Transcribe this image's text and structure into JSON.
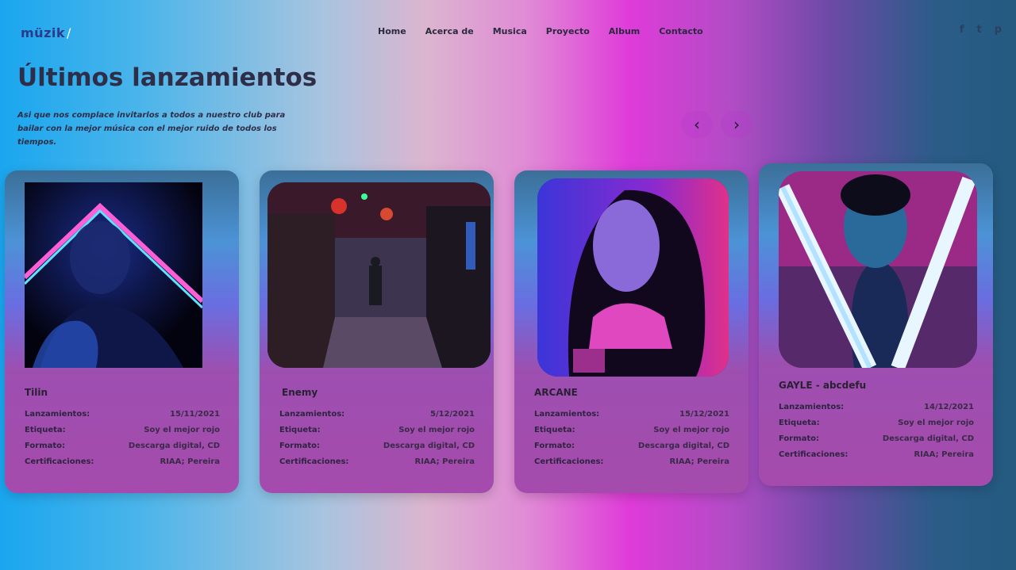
{
  "brand": {
    "logo": "müzik",
    "logo_mark": "/"
  },
  "nav": [
    "Home",
    "Acerca de",
    "Musica",
    "Proyecto",
    "Album",
    "Contacto"
  ],
  "social": {
    "facebook": "f",
    "twitter": "t",
    "pinterest": "p"
  },
  "hero": {
    "title": "Últimos lanzamientos",
    "subtitle": "Asi que nos complace invitarlos a todos a nuestro club para bailar con la mejor música con el mejor ruido de todos los tiempos."
  },
  "carousel": {
    "prev": "‹",
    "next": "›"
  },
  "field_labels": {
    "release": "Lanzamientos:",
    "label": "Etiqueta:",
    "format": "Formato:",
    "certs": "Certificaciones:"
  },
  "cards": [
    {
      "title": "Tilin",
      "release": "15/11/2021",
      "label": "Soy el mejor rojo",
      "format": "Descarga digital, CD",
      "certs": "RIAA; Pereira"
    },
    {
      "title": "Enemy",
      "release": "5/12/2021",
      "label": "Soy el mejor rojo",
      "format": "Descarga digital, CD",
      "certs": "RIAA; Pereira"
    },
    {
      "title": "ARCANE",
      "release": "15/12/2021",
      "label": "Soy el mejor rojo",
      "format": "Descarga digital, CD",
      "certs": "RIAA; Pereira"
    },
    {
      "title": "GAYLE - abcdefu",
      "release": "14/12/2021",
      "label": "Soy el mejor rojo",
      "format": "Descarga digital, CD",
      "certs": "RIAA; Pereira"
    }
  ]
}
